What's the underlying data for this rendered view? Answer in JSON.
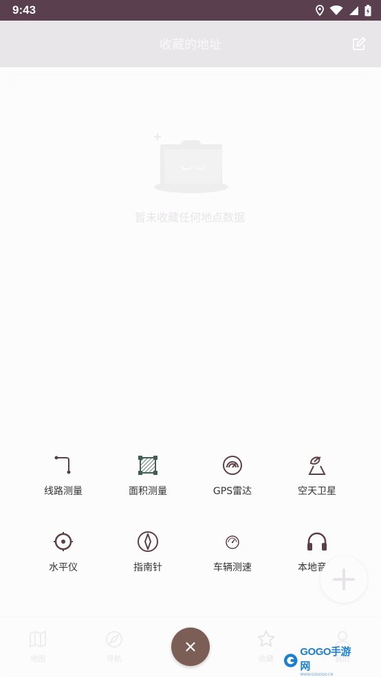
{
  "status_bar": {
    "time": "9:43"
  },
  "header": {
    "title": "收藏的地址"
  },
  "empty_state": {
    "message": "暂未收藏任何地点数据"
  },
  "tools": [
    {
      "label": "线路测量",
      "icon": "route-icon"
    },
    {
      "label": "面积测量",
      "icon": "area-icon"
    },
    {
      "label": "GPS雷达",
      "icon": "radar-icon"
    },
    {
      "label": "空天卫星",
      "icon": "satellite-dish-icon"
    },
    {
      "label": "水平仪",
      "icon": "level-icon"
    },
    {
      "label": "指南针",
      "icon": "compass-icon"
    },
    {
      "label": "车辆测速",
      "icon": "speedometer-icon"
    },
    {
      "label": "本地音乐",
      "icon": "headphones-icon"
    }
  ],
  "bottom_nav": {
    "items": [
      {
        "label": "地图",
        "icon": "map-icon"
      },
      {
        "label": "导航",
        "icon": "navigation-icon"
      },
      {
        "label": "收藏",
        "icon": "star-icon"
      },
      {
        "label": "我的",
        "icon": "person-icon"
      }
    ]
  },
  "watermark": {
    "text": "GOGO手游网",
    "sub": "WWW.GOGOGO.CN"
  },
  "colors": {
    "status_bar": "#5a3f4e",
    "header_bg": "#e8e6e8",
    "fab_close": "#7b5e55",
    "tool_icon": "#5b3f44",
    "tool_icon_green": "#3f5f54"
  }
}
